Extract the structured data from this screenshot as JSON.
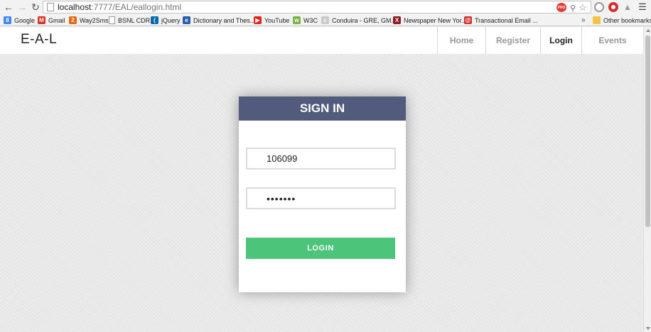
{
  "browser": {
    "url_host": "localhost",
    "url_rest": ":7777/EAL/eallogin.html",
    "bookmarks": [
      {
        "label": "Google",
        "icon": "google-icon",
        "color": "#4285f4",
        "glyph": "8"
      },
      {
        "label": "Gmail",
        "icon": "gmail-icon",
        "color": "#d93025",
        "glyph": "M"
      },
      {
        "label": "Way2Sms",
        "icon": "way2sms-icon",
        "color": "#e86a10",
        "glyph": "2"
      },
      {
        "label": "BSNL CDR",
        "icon": "page-icon",
        "color": "#9a9a9a",
        "glyph": ""
      },
      {
        "label": "jQuery",
        "icon": "jquery-icon",
        "color": "#0769ad",
        "glyph": "("
      },
      {
        "label": "Dictionary and Thes...",
        "icon": "dictionary-icon",
        "color": "#2a5db0",
        "glyph": "e"
      },
      {
        "label": "YouTube",
        "icon": "youtube-icon",
        "color": "#e62117",
        "glyph": "▶"
      },
      {
        "label": "W3C",
        "icon": "w3c-icon",
        "color": "#7cb342",
        "glyph": "w"
      },
      {
        "label": "Conduira - GRE, GM...",
        "icon": "conduira-icon",
        "color": "#c9c9c9",
        "glyph": "c"
      },
      {
        "label": "Newspaper New Yor...",
        "icon": "newspaper-icon",
        "color": "#8b1a1a",
        "glyph": "X"
      },
      {
        "label": "Transactional Email ...",
        "icon": "email-icon",
        "color": "#d0312d",
        "glyph": "@"
      }
    ],
    "more_bookmarks": "»",
    "other_bookmarks": "Other bookmarks"
  },
  "site": {
    "brand": "E-A-L",
    "nav": [
      {
        "label": "Home",
        "active": false
      },
      {
        "label": "Register",
        "active": false
      },
      {
        "label": "Login",
        "active": true
      },
      {
        "label": "Events",
        "active": false
      }
    ]
  },
  "login": {
    "title": "SIGN IN",
    "username_value": "106099",
    "password_value": "•••••••",
    "button_label": "LOGIN"
  },
  "colors": {
    "card_header": "#525b7c",
    "login_button": "#4cc47a",
    "page_bg": "#e8e8e8"
  }
}
